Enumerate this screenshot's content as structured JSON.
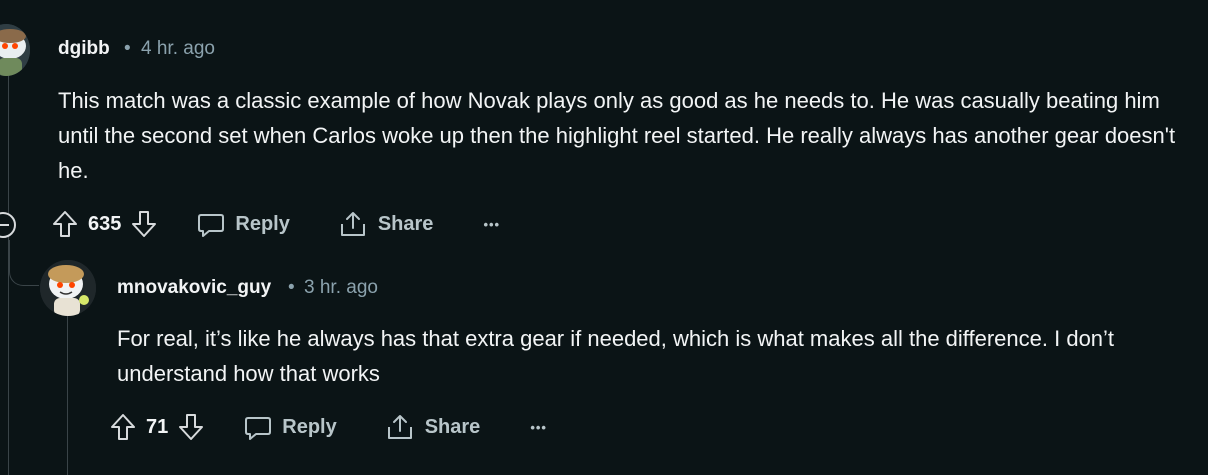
{
  "comments": [
    {
      "username": "dgibb",
      "separator": "•",
      "time": "4 hr. ago",
      "body": "This match was a classic example of how Novak plays only as good as he needs to. He was casually beating him until the second set when Carlos woke up then the highlight reel started. He really always has another gear doesn't he.",
      "votes": "635",
      "reply_label": "Reply",
      "share_label": "Share",
      "more_label": "•••"
    },
    {
      "username": "mnovakovic_guy",
      "separator": "•",
      "time": "3 hr. ago",
      "body": "For real, it’s like he always has that extra gear if needed, which is what makes all the difference. I don’t understand how that works",
      "votes": "71",
      "reply_label": "Reply",
      "share_label": "Share",
      "more_label": "•••"
    }
  ],
  "colors": {
    "background": "#0b1416",
    "text": "#f2f4f5",
    "meta": "#8ba2ad",
    "action": "#b8c5c9",
    "thread_line": "#3a4448"
  }
}
